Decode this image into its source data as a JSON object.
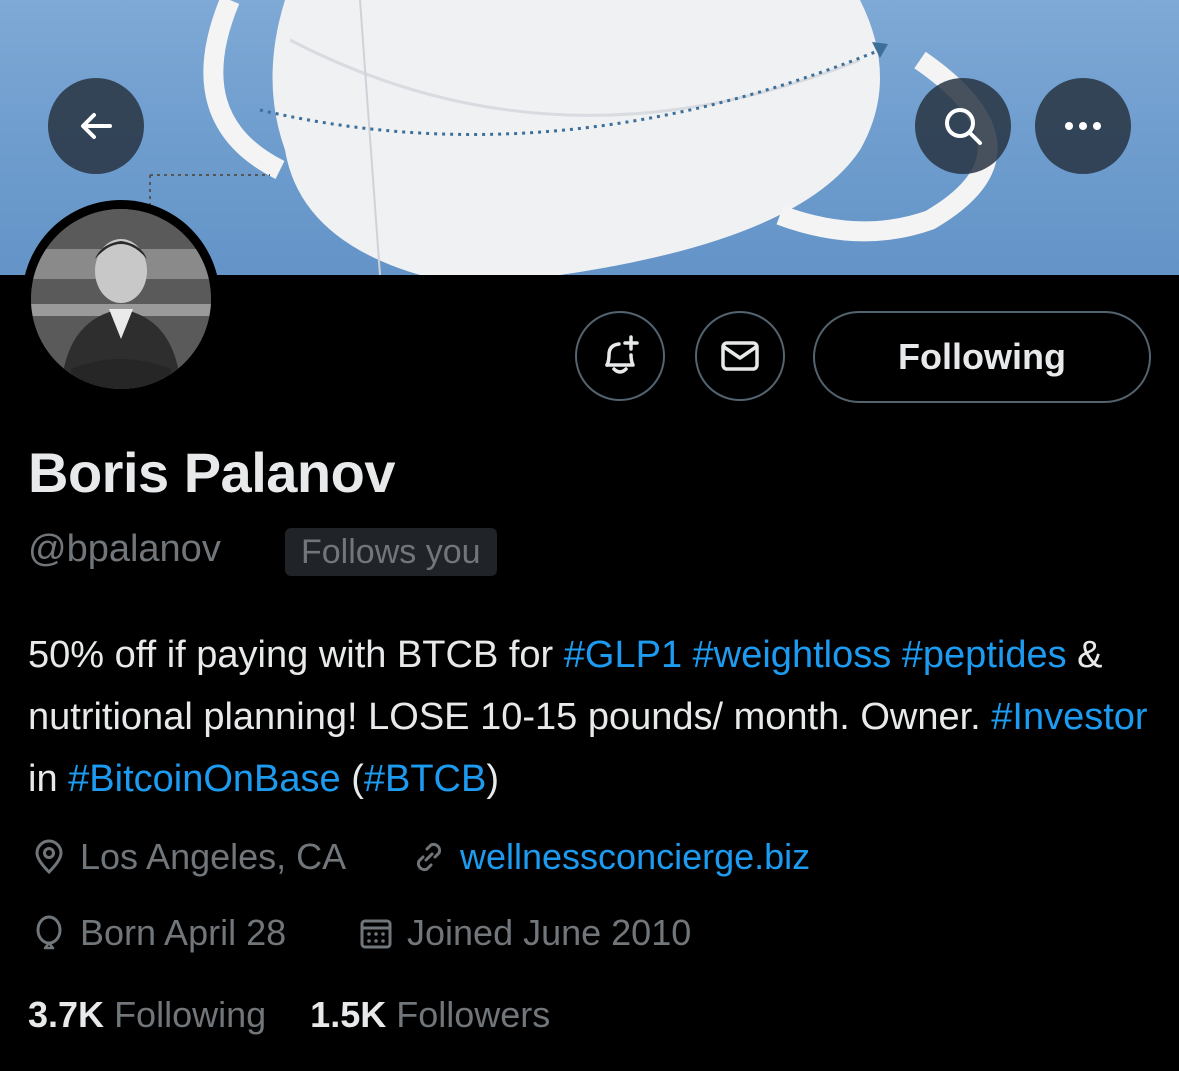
{
  "header": {
    "back_icon": "arrow-left-icon",
    "search_icon": "search-icon",
    "more_icon": "more-horizontal-icon"
  },
  "profile": {
    "name": "Boris Palanov",
    "handle": "@bpalanov",
    "follows_you": "Follows you",
    "bio_segments": [
      {
        "text": "50% off if paying with BTCB for ",
        "tag": false
      },
      {
        "text": "#GLP1",
        "tag": true
      },
      {
        "text": " ",
        "tag": false
      },
      {
        "text": "#weightloss",
        "tag": true
      },
      {
        "text": " ",
        "tag": false
      },
      {
        "text": "#peptides",
        "tag": true
      },
      {
        "text": " & nutritional planning! LOSE 10-15 pounds/ month. Owner. ",
        "tag": false
      },
      {
        "text": "#Investor",
        "tag": true
      },
      {
        "text": " in ",
        "tag": false
      },
      {
        "text": "#BitcoinOnBase",
        "tag": true
      },
      {
        "text": " (",
        "tag": false
      },
      {
        "text": "#BTCB",
        "tag": true
      },
      {
        "text": ")",
        "tag": false
      }
    ],
    "location": "Los Angeles, CA",
    "website": "wellnessconcierge.biz",
    "birthday": "Born April 28",
    "joined": "Joined June 2010"
  },
  "actions": {
    "notify_icon": "bell-plus-icon",
    "message_icon": "envelope-icon",
    "following_label": "Following"
  },
  "stats": {
    "following_count": "3.7K",
    "following_label": "Following",
    "followers_count": "1.5K",
    "followers_label": "Followers"
  },
  "colors": {
    "accent": "#1d9bf0",
    "muted": "#71767b",
    "text": "#e7e9ea",
    "background": "#000000"
  }
}
